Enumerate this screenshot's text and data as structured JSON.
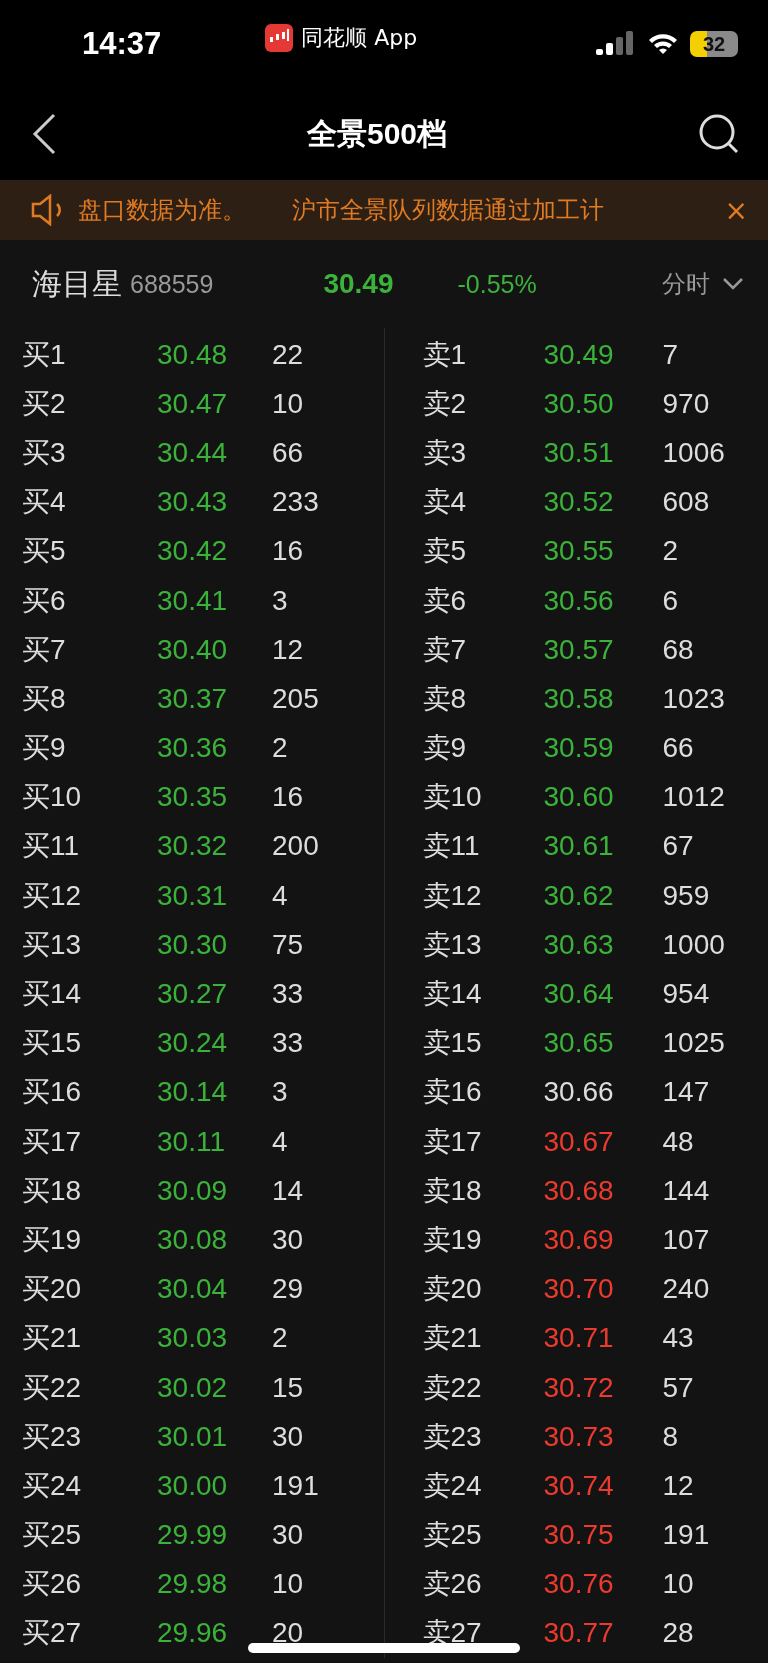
{
  "status_bar": {
    "time": "14:37",
    "app": "同花顺 App",
    "battery": "32"
  },
  "nav": {
    "title": "全景500档"
  },
  "notice": {
    "texts": [
      "盘口数据为准。",
      "沪市全景队列数据通过加工计"
    ],
    "close": "×"
  },
  "stock": {
    "name": "海目星",
    "code": "688559",
    "price": "30.49",
    "change": "-0.55%",
    "period": "分时"
  },
  "buy": [
    {
      "label": "买1",
      "price": "30.48",
      "volume": "22",
      "color": "#3bb33a"
    },
    {
      "label": "买2",
      "price": "30.47",
      "volume": "10",
      "color": "#3bb33a"
    },
    {
      "label": "买3",
      "price": "30.44",
      "volume": "66",
      "color": "#3bb33a"
    },
    {
      "label": "买4",
      "price": "30.43",
      "volume": "233",
      "color": "#3bb33a"
    },
    {
      "label": "买5",
      "price": "30.42",
      "volume": "16",
      "color": "#3bb33a"
    },
    {
      "label": "买6",
      "price": "30.41",
      "volume": "3",
      "color": "#3bb33a"
    },
    {
      "label": "买7",
      "price": "30.40",
      "volume": "12",
      "color": "#3bb33a"
    },
    {
      "label": "买8",
      "price": "30.37",
      "volume": "205",
      "color": "#3bb33a"
    },
    {
      "label": "买9",
      "price": "30.36",
      "volume": "2",
      "color": "#3bb33a"
    },
    {
      "label": "买10",
      "price": "30.35",
      "volume": "16",
      "color": "#3bb33a"
    },
    {
      "label": "买11",
      "price": "30.32",
      "volume": "200",
      "color": "#3bb33a"
    },
    {
      "label": "买12",
      "price": "30.31",
      "volume": "4",
      "color": "#3bb33a"
    },
    {
      "label": "买13",
      "price": "30.30",
      "volume": "75",
      "color": "#3bb33a"
    },
    {
      "label": "买14",
      "price": "30.27",
      "volume": "33",
      "color": "#3bb33a"
    },
    {
      "label": "买15",
      "price": "30.24",
      "volume": "33",
      "color": "#3bb33a"
    },
    {
      "label": "买16",
      "price": "30.14",
      "volume": "3",
      "color": "#3bb33a"
    },
    {
      "label": "买17",
      "price": "30.11",
      "volume": "4",
      "color": "#3bb33a"
    },
    {
      "label": "买18",
      "price": "30.09",
      "volume": "14",
      "color": "#3bb33a"
    },
    {
      "label": "买19",
      "price": "30.08",
      "volume": "30",
      "color": "#3bb33a"
    },
    {
      "label": "买20",
      "price": "30.04",
      "volume": "29",
      "color": "#3bb33a"
    },
    {
      "label": "买21",
      "price": "30.03",
      "volume": "2",
      "color": "#3bb33a"
    },
    {
      "label": "买22",
      "price": "30.02",
      "volume": "15",
      "color": "#3bb33a"
    },
    {
      "label": "买23",
      "price": "30.01",
      "volume": "30",
      "color": "#3bb33a"
    },
    {
      "label": "买24",
      "price": "30.00",
      "volume": "191",
      "color": "#3bb33a"
    },
    {
      "label": "买25",
      "price": "29.99",
      "volume": "30",
      "color": "#3bb33a"
    },
    {
      "label": "买26",
      "price": "29.98",
      "volume": "10",
      "color": "#3bb33a"
    },
    {
      "label": "买27",
      "price": "29.96",
      "volume": "20",
      "color": "#3bb33a"
    }
  ],
  "sell": [
    {
      "label": "卖1",
      "price": "30.49",
      "volume": "7",
      "color": "#3bb33a"
    },
    {
      "label": "卖2",
      "price": "30.50",
      "volume": "970",
      "color": "#3bb33a"
    },
    {
      "label": "卖3",
      "price": "30.51",
      "volume": "1006",
      "color": "#3bb33a"
    },
    {
      "label": "卖4",
      "price": "30.52",
      "volume": "608",
      "color": "#3bb33a"
    },
    {
      "label": "卖5",
      "price": "30.55",
      "volume": "2",
      "color": "#3bb33a"
    },
    {
      "label": "卖6",
      "price": "30.56",
      "volume": "6",
      "color": "#3bb33a"
    },
    {
      "label": "卖7",
      "price": "30.57",
      "volume": "68",
      "color": "#3bb33a"
    },
    {
      "label": "卖8",
      "price": "30.58",
      "volume": "1023",
      "color": "#3bb33a"
    },
    {
      "label": "卖9",
      "price": "30.59",
      "volume": "66",
      "color": "#3bb33a"
    },
    {
      "label": "卖10",
      "price": "30.60",
      "volume": "1012",
      "color": "#3bb33a"
    },
    {
      "label": "卖11",
      "price": "30.61",
      "volume": "67",
      "color": "#3bb33a"
    },
    {
      "label": "卖12",
      "price": "30.62",
      "volume": "959",
      "color": "#3bb33a"
    },
    {
      "label": "卖13",
      "price": "30.63",
      "volume": "1000",
      "color": "#3bb33a"
    },
    {
      "label": "卖14",
      "price": "30.64",
      "volume": "954",
      "color": "#3bb33a"
    },
    {
      "label": "卖15",
      "price": "30.65",
      "volume": "1025",
      "color": "#3bb33a"
    },
    {
      "label": "卖16",
      "price": "30.66",
      "volume": "147",
      "color": "#dddddd"
    },
    {
      "label": "卖17",
      "price": "30.67",
      "volume": "48",
      "color": "#ec3b2e"
    },
    {
      "label": "卖18",
      "price": "30.68",
      "volume": "144",
      "color": "#ec3b2e"
    },
    {
      "label": "卖19",
      "price": "30.69",
      "volume": "107",
      "color": "#ec3b2e"
    },
    {
      "label": "卖20",
      "price": "30.70",
      "volume": "240",
      "color": "#ec3b2e"
    },
    {
      "label": "卖21",
      "price": "30.71",
      "volume": "43",
      "color": "#ec3b2e"
    },
    {
      "label": "卖22",
      "price": "30.72",
      "volume": "57",
      "color": "#ec3b2e"
    },
    {
      "label": "卖23",
      "price": "30.73",
      "volume": "8",
      "color": "#ec3b2e"
    },
    {
      "label": "卖24",
      "price": "30.74",
      "volume": "12",
      "color": "#ec3b2e"
    },
    {
      "label": "卖25",
      "price": "30.75",
      "volume": "191",
      "color": "#ec3b2e"
    },
    {
      "label": "卖26",
      "price": "30.76",
      "volume": "10",
      "color": "#ec3b2e"
    },
    {
      "label": "卖27",
      "price": "30.77",
      "volume": "28",
      "color": "#ec3b2e"
    }
  ]
}
